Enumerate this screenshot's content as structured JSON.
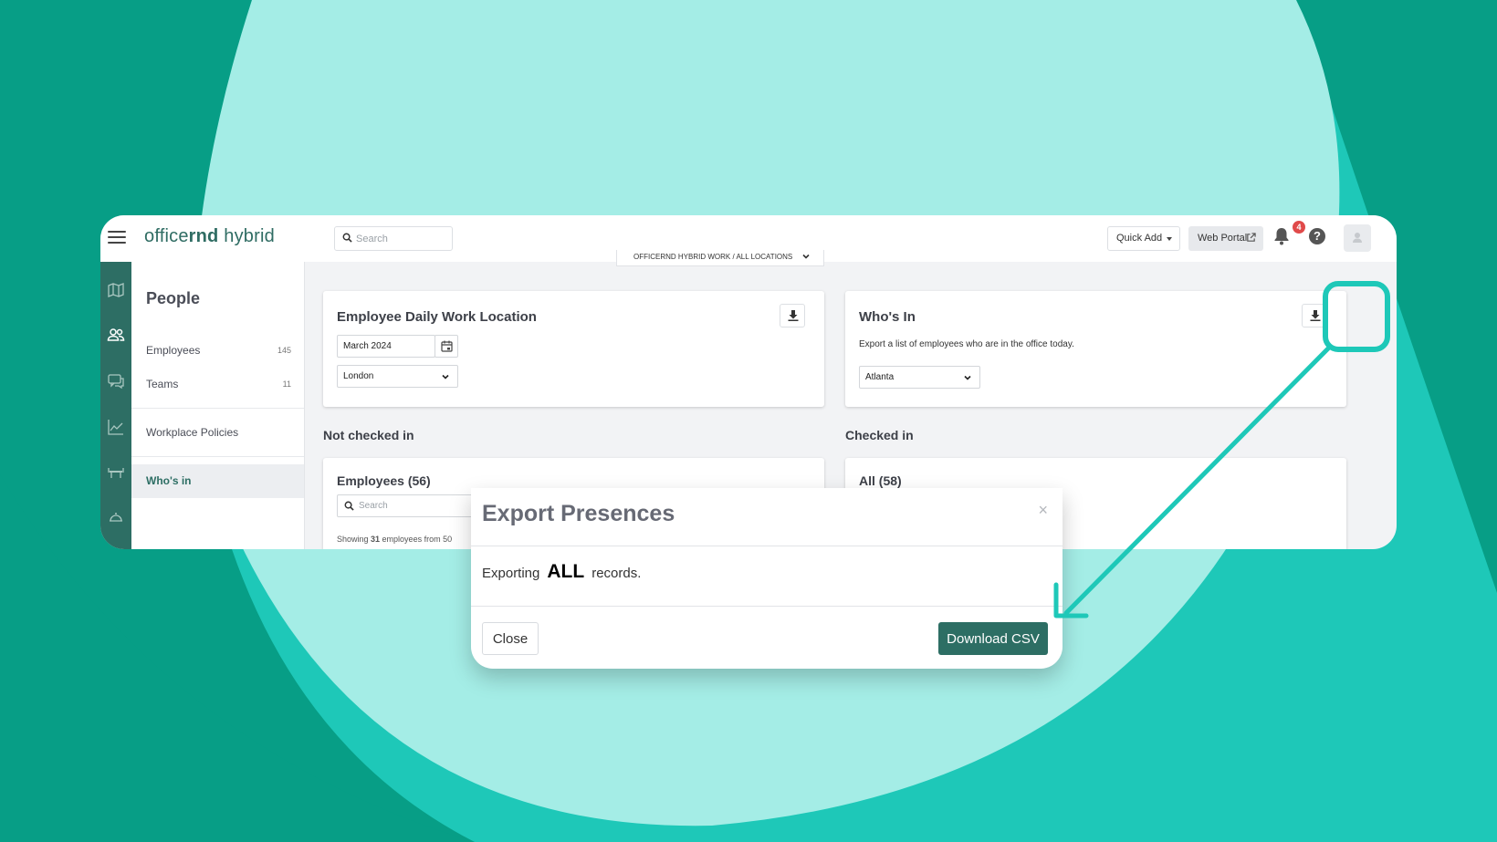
{
  "colors": {
    "brand": "#2d6e64",
    "bg_light": "#a4ede6",
    "bg_dark": "#079e86",
    "bg_mid": "#1ec8b8",
    "highlight": "#1ec8b8",
    "badge": "#e04a4a"
  },
  "app": {
    "logo_light": "office",
    "logo_bold": "rnd",
    "logo_suffix": " hybrid",
    "search_placeholder": "Search",
    "quick_add": "Quick Add",
    "web_portal": "Web Portal",
    "notification_count": "4",
    "help": "?"
  },
  "rail": {
    "icons": [
      "map-icon",
      "people-icon",
      "chat-icon",
      "chart-icon",
      "desk-icon",
      "reception-icon"
    ],
    "active": "people-icon"
  },
  "sidebar": {
    "title": "People",
    "items": [
      {
        "label": "Employees",
        "count": "145"
      },
      {
        "label": "Teams",
        "count": "11"
      },
      {
        "label": "Workplace Policies",
        "count": ""
      },
      {
        "label": "Who's in",
        "count": ""
      }
    ],
    "active_item": "Who's in"
  },
  "breadcrumb": {
    "text": "OFFICERND HYBRID WORK  /  ALL LOCATIONS"
  },
  "daily_card": {
    "title": "Employee Daily Work Location",
    "month": "March 2024",
    "location": "London"
  },
  "whos_in_card": {
    "title": "Who's In",
    "description": "Export a list of employees who are in the office today.",
    "location": "Atlanta"
  },
  "not_checked_in": {
    "heading": "Not checked in",
    "card_title": "Employees (56)",
    "search_placeholder": "Search",
    "showing_prefix": "Showing ",
    "showing_count": "31",
    "showing_suffix": " employees from 50"
  },
  "checked_in": {
    "heading": "Checked in",
    "card_title": "All (58)"
  },
  "modal": {
    "title": "Export Presences",
    "close_glyph": "×",
    "body_prefix": "Exporting",
    "body_strong": "ALL",
    "body_suffix": "records.",
    "close_button": "Close",
    "download_button": "Download CSV"
  }
}
